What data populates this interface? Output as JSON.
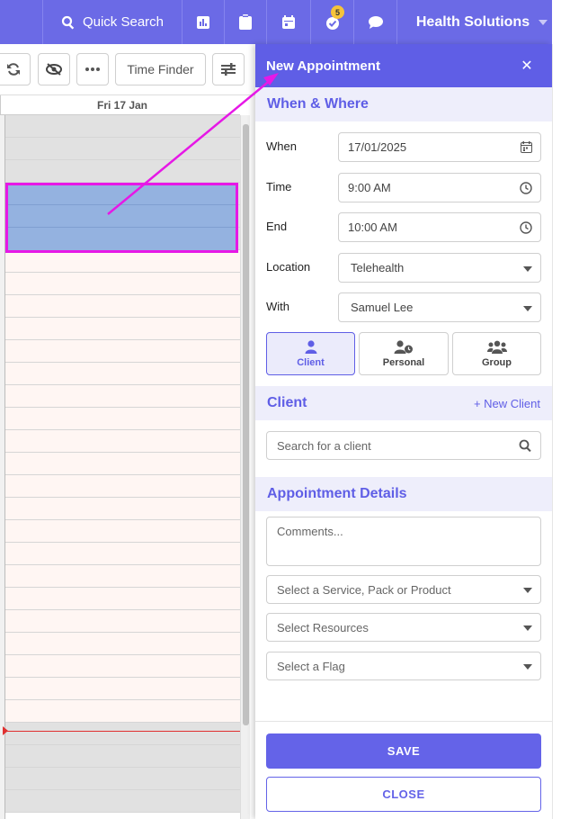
{
  "topbar": {
    "quick_search_label": "Quick Search",
    "notification_count": "5",
    "org_name": "Health Solutions",
    "icons": [
      "search-icon",
      "report-icon",
      "clipboard-icon",
      "calendar-icon",
      "tasks-icon",
      "chat-icon",
      "chevron-down-icon"
    ]
  },
  "toolbar": {
    "time_finder_label": "Time Finder",
    "icons": [
      "refresh-icon",
      "hide-icon",
      "more-icon",
      "settings-icon"
    ]
  },
  "calendar": {
    "day_header": "Fri 17 Jan"
  },
  "panel": {
    "title": "New Appointment",
    "close_glyph": "✕",
    "when_where": {
      "heading": "When & Where",
      "when_label": "When",
      "when_value": "17/01/2025",
      "time_label": "Time",
      "time_value": "9:00 AM",
      "end_label": "End",
      "end_value": "10:00 AM",
      "location_label": "Location",
      "location_value": "Telehealth",
      "with_label": "With",
      "with_value": "Samuel Lee"
    },
    "types": [
      {
        "label": "Client",
        "icon": "user-icon",
        "selected": true
      },
      {
        "label": "Personal",
        "icon": "user-clock-icon",
        "selected": false
      },
      {
        "label": "Group",
        "icon": "users-icon",
        "selected": false
      }
    ],
    "client": {
      "heading": "Client",
      "new_client_label": "+ New Client",
      "search_placeholder": "Search for a client"
    },
    "details": {
      "heading": "Appointment Details",
      "comments_placeholder": "Comments...",
      "service_placeholder": "Select a Service, Pack or Product",
      "resources_placeholder": "Select Resources",
      "flag_placeholder": "Select a Flag"
    },
    "actions": {
      "save_label": "SAVE",
      "close_label": "CLOSE"
    }
  },
  "colors": {
    "brand": "#6b6ae6",
    "accent": "#5f5ee6",
    "selection": "#94b2e0",
    "annotation": "#e618e6",
    "now_line": "#e03030"
  }
}
